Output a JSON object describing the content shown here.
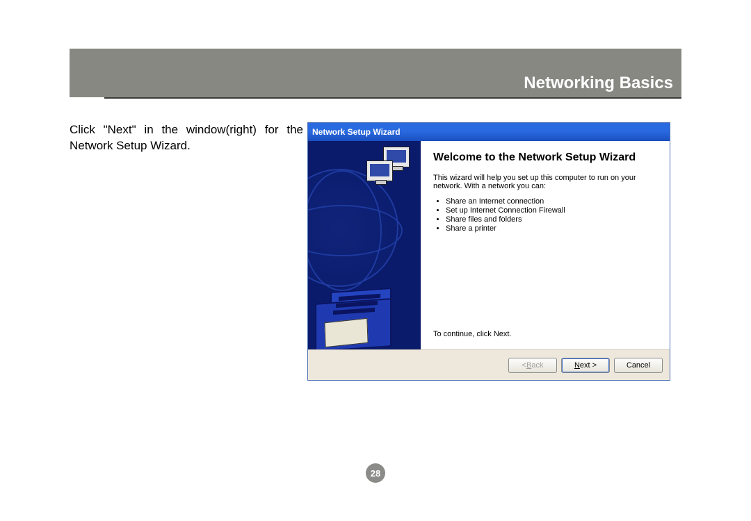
{
  "header": {
    "title": "Networking Basics"
  },
  "instruction": "Click \"Next\" in the window(right) for the Network Setup Wizard.",
  "wizard": {
    "titlebar": "Network Setup Wizard",
    "heading": "Welcome to the Network Setup Wizard",
    "intro": "This wizard will help you set up this computer to run on your network. With a network you can:",
    "bullets": [
      "Share an Internet connection",
      "Set up Internet Connection Firewall",
      "Share files and folders",
      "Share a printer"
    ],
    "continue_text": "To continue, click Next.",
    "buttons": {
      "back_prefix": "< ",
      "back_u": "B",
      "back_rest": "ack",
      "next_u": "N",
      "next_rest": "ext >",
      "cancel": "Cancel"
    }
  },
  "page_number": "28"
}
